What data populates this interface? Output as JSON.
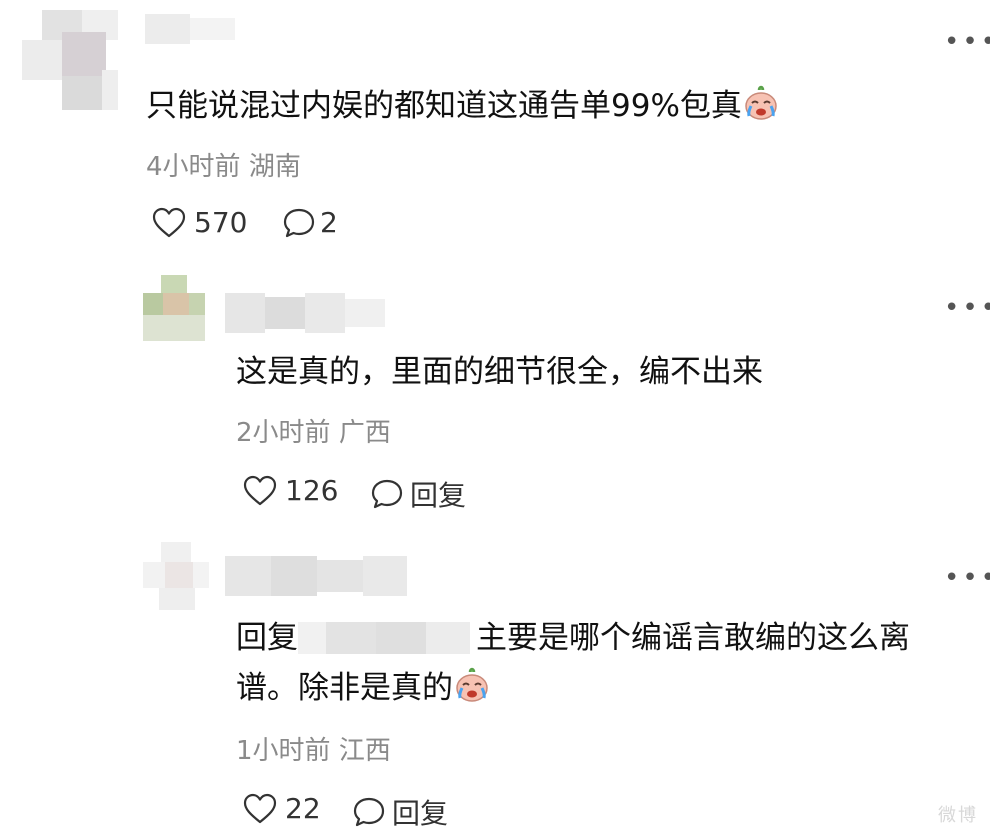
{
  "comments": [
    {
      "text": "只能说混过内娱的都知道这通告单99%包真",
      "time": "4小时前",
      "location": "湖南",
      "likes": "570",
      "replies": "2",
      "emoji": "crying-face-icon"
    },
    {
      "text": "这是真的，里面的细节很全，编不出来",
      "time": "2小时前",
      "location": "广西",
      "likes": "126",
      "reply_label": "回复"
    },
    {
      "reply_prefix": "回复",
      "text_line1": "主要是哪个编谣言敢编的这么离",
      "text_line2": "谱。除非是真的",
      "time": "1小时前",
      "location": "江西",
      "likes": "22",
      "reply_label": "回复",
      "emoji": "crying-face-icon"
    }
  ],
  "more_label": "•••",
  "watermark": "微博"
}
